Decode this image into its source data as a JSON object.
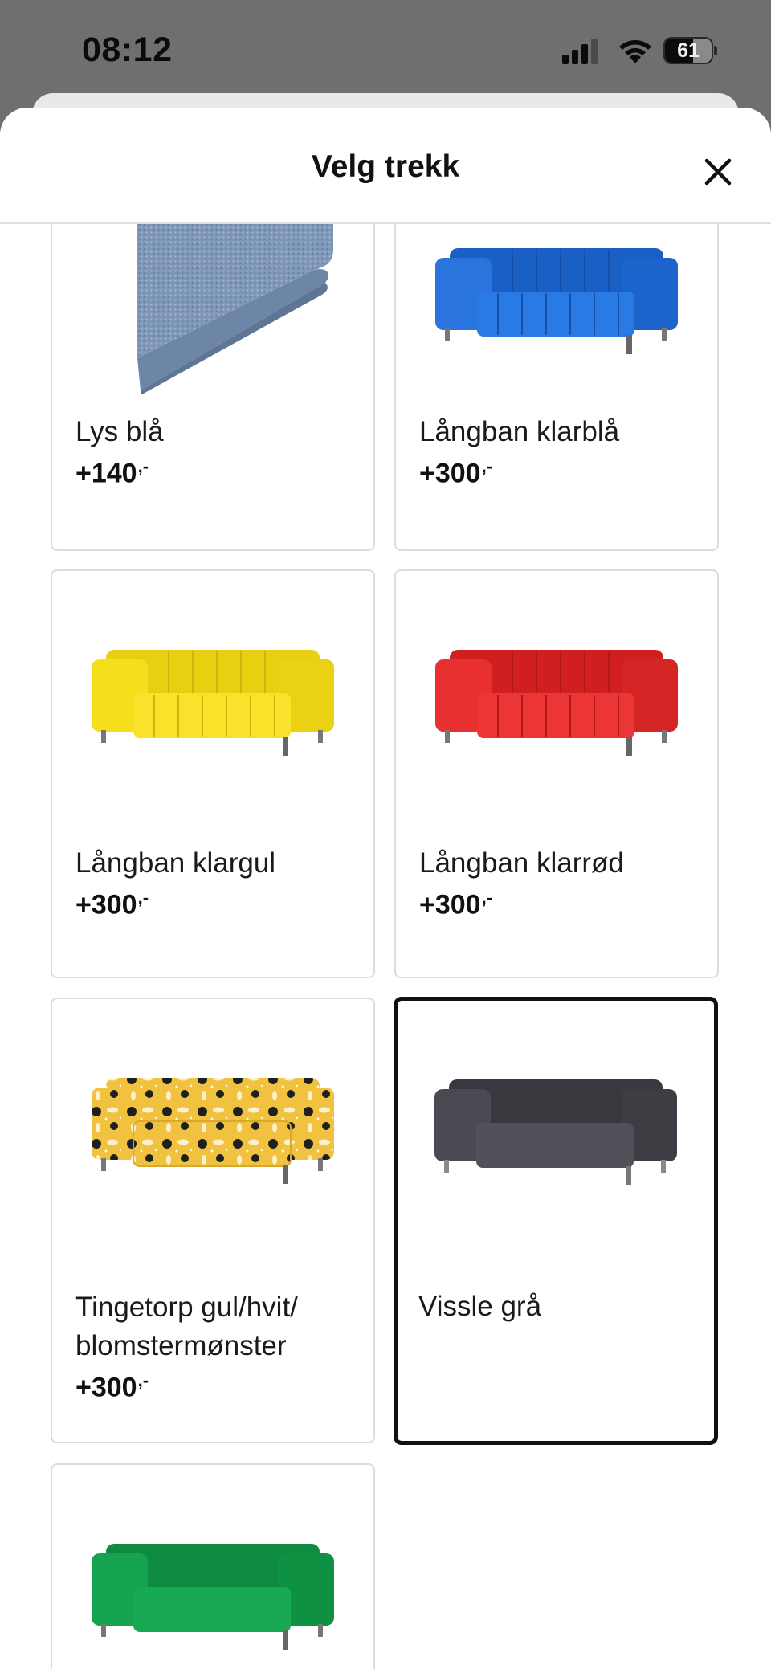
{
  "status_bar": {
    "time": "08:12",
    "battery_level": "61",
    "icons": [
      "signal-icon",
      "wifi-icon",
      "battery-icon"
    ]
  },
  "sheet": {
    "title": "Velg trekk",
    "close_icon": "close-icon"
  },
  "price_suffix": ",-",
  "covers": [
    {
      "name": "Lys blå",
      "price": "+140",
      "image": "fabric-swatch",
      "color": "#7f97b8",
      "selected": false
    },
    {
      "name": "Långban klarblå",
      "price": "+300",
      "image": "sofa",
      "color": "#1f6fd9",
      "selected": false
    },
    {
      "name": "Långban klargul",
      "price": "+300",
      "image": "sofa",
      "color": "#f4dc17",
      "selected": false
    },
    {
      "name": "Långban klarrød",
      "price": "+300",
      "image": "sofa",
      "color": "#e52b2b",
      "selected": false
    },
    {
      "name": "Tingetorp gul/hvit/ blomstermønster",
      "price": "+300",
      "image": "sofa-patterned",
      "color": "#f0c23f",
      "selected": false
    },
    {
      "name": "Vissle grå",
      "price": "",
      "image": "sofa",
      "color": "#45464d",
      "selected": true
    },
    {
      "name": "",
      "price": "",
      "image": "sofa",
      "color": "#119a4a",
      "selected": false
    }
  ]
}
